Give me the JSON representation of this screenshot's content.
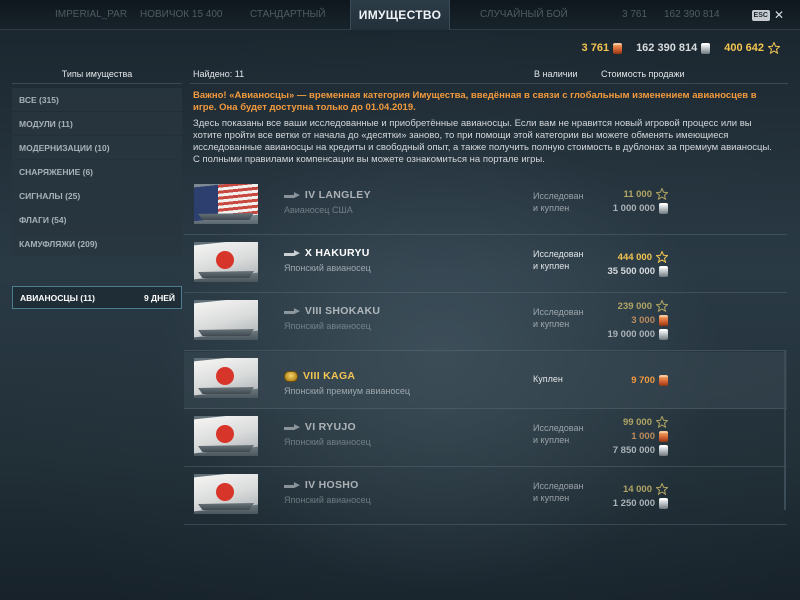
{
  "window": {
    "title": "ИМУЩЕСТВО",
    "esc_label": "ESC",
    "close_glyph": "✕"
  },
  "topbar_ghost": [
    "IMPERIAL_PAR",
    "НОВИЧОК 15 400",
    "СТАНДАРТНЫЙ",
    "СЛУЧАЙНЫЙ БОЙ",
    "3 761",
    "162 390 814",
    "400 642"
  ],
  "currencies": {
    "doubloons": "3 761",
    "credits": "162 390 814",
    "free_xp": "400 642"
  },
  "colors": {
    "accent_orange": "#f29a3d",
    "gold": "#f2c451",
    "active_border": "#4c7d8e"
  },
  "sidebar": {
    "header": "Типы имущества",
    "items": [
      {
        "label": "ВСЕ (315)"
      },
      {
        "label": "МОДУЛИ (11)"
      },
      {
        "label": "МОДЕРНИЗАЦИИ (10)"
      },
      {
        "label": "СНАРЯЖЕНИЕ (6)"
      },
      {
        "label": "СИГНАЛЫ (25)"
      },
      {
        "label": "ФЛАГИ (54)"
      },
      {
        "label": "КАМУФЛЯЖИ (209)"
      }
    ],
    "active": {
      "label": "АВИАНОСЦЫ (11)",
      "timer": "9 дней"
    }
  },
  "list": {
    "found": "Найдено: 11",
    "col_stock": "В наличии",
    "col_price": "Стоимость продажи",
    "warning": "Важно! «Авианосцы» — временная категория Имущества, введённая в связи с глобальным изменением авианосцев в игре. Она будет доступна только до 01.04.2019.",
    "info": "Здесь показаны все ваши исследованные и приобретённые авианосцы. Если вам не нравится новый игровой процесс или вы хотите пройти все ветки от начала до «десятки» заново, то при помощи этой категории вы можете обменять имеющиеся исследованные авианосцы на кредиты и свободный опыт, а также получить полную стоимость в дублонах за премиум авианосцы.",
    "info2": "С полными правилами компенсации вы можете ознакомиться на портале игры."
  },
  "ships": [
    {
      "name": "IV LANGLEY",
      "type": "Авианосец США",
      "status_l1": "Исследован",
      "status_l2": "и куплен",
      "xp": "11 000",
      "dbl": "",
      "cred": "1 000 000",
      "nation": "usa"
    },
    {
      "name": "X HAKURYU",
      "type": "Японский авианосец",
      "status_l1": "Исследован",
      "status_l2": "и куплен",
      "xp": "444 000",
      "dbl": "",
      "cred": "35 500 000",
      "nation": "japan"
    },
    {
      "name": "VIII SHOKAKU",
      "type": "Японский авианосец",
      "status_l1": "Исследован",
      "status_l2": "и куплен",
      "xp": "239 000",
      "dbl": "3 000",
      "cred": "19 000 000",
      "nation": "japan"
    },
    {
      "name": "VIII KAGA",
      "type": "Японский премиум авианосец",
      "status_l1": "Куплен",
      "status_l2": "",
      "xp": "",
      "dbl": "9 700",
      "cred": "",
      "nation": "japan",
      "premium": true
    },
    {
      "name": "VI RYUJO",
      "type": "Японский авианосец",
      "status_l1": "Исследован",
      "status_l2": "и куплен",
      "xp": "99 000",
      "dbl": "1 000",
      "cred": "7 850 000",
      "nation": "japan"
    },
    {
      "name": "IV HOSHO",
      "type": "Японский авианосец",
      "status_l1": "Исследован",
      "status_l2": "и куплен",
      "xp": "14 000",
      "dbl": "",
      "cred": "1 250 000",
      "nation": "japan"
    }
  ]
}
